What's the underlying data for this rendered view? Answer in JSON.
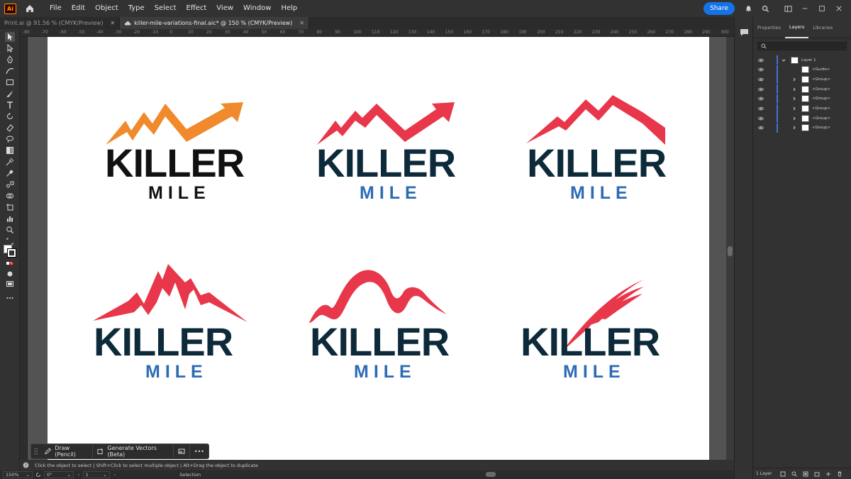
{
  "app": {
    "logo_text": "Ai",
    "menu": [
      "File",
      "Edit",
      "Object",
      "Type",
      "Select",
      "Effect",
      "View",
      "Window",
      "Help"
    ],
    "share_label": "Share"
  },
  "tabs": [
    {
      "label": "Print.ai @ 91.56 % (CMYK/Preview)",
      "active": false
    },
    {
      "label": "killer-mile-variations-final.aic* @ 150 % (CMYK/Preview)",
      "active": true
    }
  ],
  "ruler": {
    "h_ticks": [
      "-80",
      "-70",
      "-60",
      "-50",
      "-40",
      "-30",
      "-20",
      "-10",
      "0",
      "10",
      "20",
      "30",
      "40",
      "50",
      "60",
      "70",
      "80",
      "90",
      "100",
      "110",
      "120",
      "130",
      "140",
      "150",
      "160",
      "170",
      "180",
      "190",
      "200",
      "210",
      "220",
      "230",
      "240",
      "250",
      "260",
      "270",
      "280",
      "290",
      "300"
    ]
  },
  "logos": [
    {
      "word1": "KILLER",
      "word2": "MILE",
      "mark": "orange-arrow",
      "word_color": "#111111",
      "mile_color": "#111111",
      "mark_color": "#f08a2c"
    },
    {
      "word1": "KILLER",
      "word2": "MILE",
      "mark": "red-arrow",
      "word_color": "#0d2a3a",
      "mile_color": "#2d6bb5",
      "mark_color": "#e8364a"
    },
    {
      "word1": "KILLER",
      "word2": "MILE",
      "mark": "red-ridge",
      "word_color": "#0d2a3a",
      "mile_color": "#2d6bb5",
      "mark_color": "#e8364a"
    },
    {
      "word1": "KILLER",
      "word2": "MILE",
      "mark": "red-mountains",
      "word_color": "#0d2a3a",
      "mile_color": "#2d6bb5",
      "mark_color": "#e8364a"
    },
    {
      "word1": "KILLER",
      "word2": "MILE",
      "mark": "red-wave",
      "word_color": "#0d2a3a",
      "mile_color": "#2d6bb5",
      "mark_color": "#e8364a"
    },
    {
      "word1": "KILLER",
      "word2": "MILE",
      "mark": "red-swoosh",
      "word_color": "#0d2a3a",
      "mile_color": "#2d6bb5",
      "mark_color": "#e8364a"
    }
  ],
  "taskbar": {
    "draw_label": "Draw (Pencil)",
    "generate_label": "Generate Vectors (Beta)",
    "more_label": "•••"
  },
  "hint": {
    "text": "Click the object to select  |  Shift+Click to select multiple object  |  Alt+Drag the object to duplicate"
  },
  "status": {
    "zoom": "150%",
    "rotation": "0°",
    "artboard_num": "1",
    "tool": "Selection"
  },
  "panel": {
    "tabs": [
      "Properties",
      "Layers",
      "Libraries"
    ],
    "active_tab": "Layers",
    "layers": [
      {
        "name": "Layer 1",
        "level": 0
      },
      {
        "name": "<Guide>",
        "level": 1
      },
      {
        "name": "<Group>",
        "level": 1
      },
      {
        "name": "<Group>",
        "level": 1
      },
      {
        "name": "<Group>",
        "level": 1
      },
      {
        "name": "<Group>",
        "level": 1
      },
      {
        "name": "<Group>",
        "level": 1
      },
      {
        "name": "<Group>",
        "level": 1
      }
    ],
    "footer": "1 Layer"
  }
}
